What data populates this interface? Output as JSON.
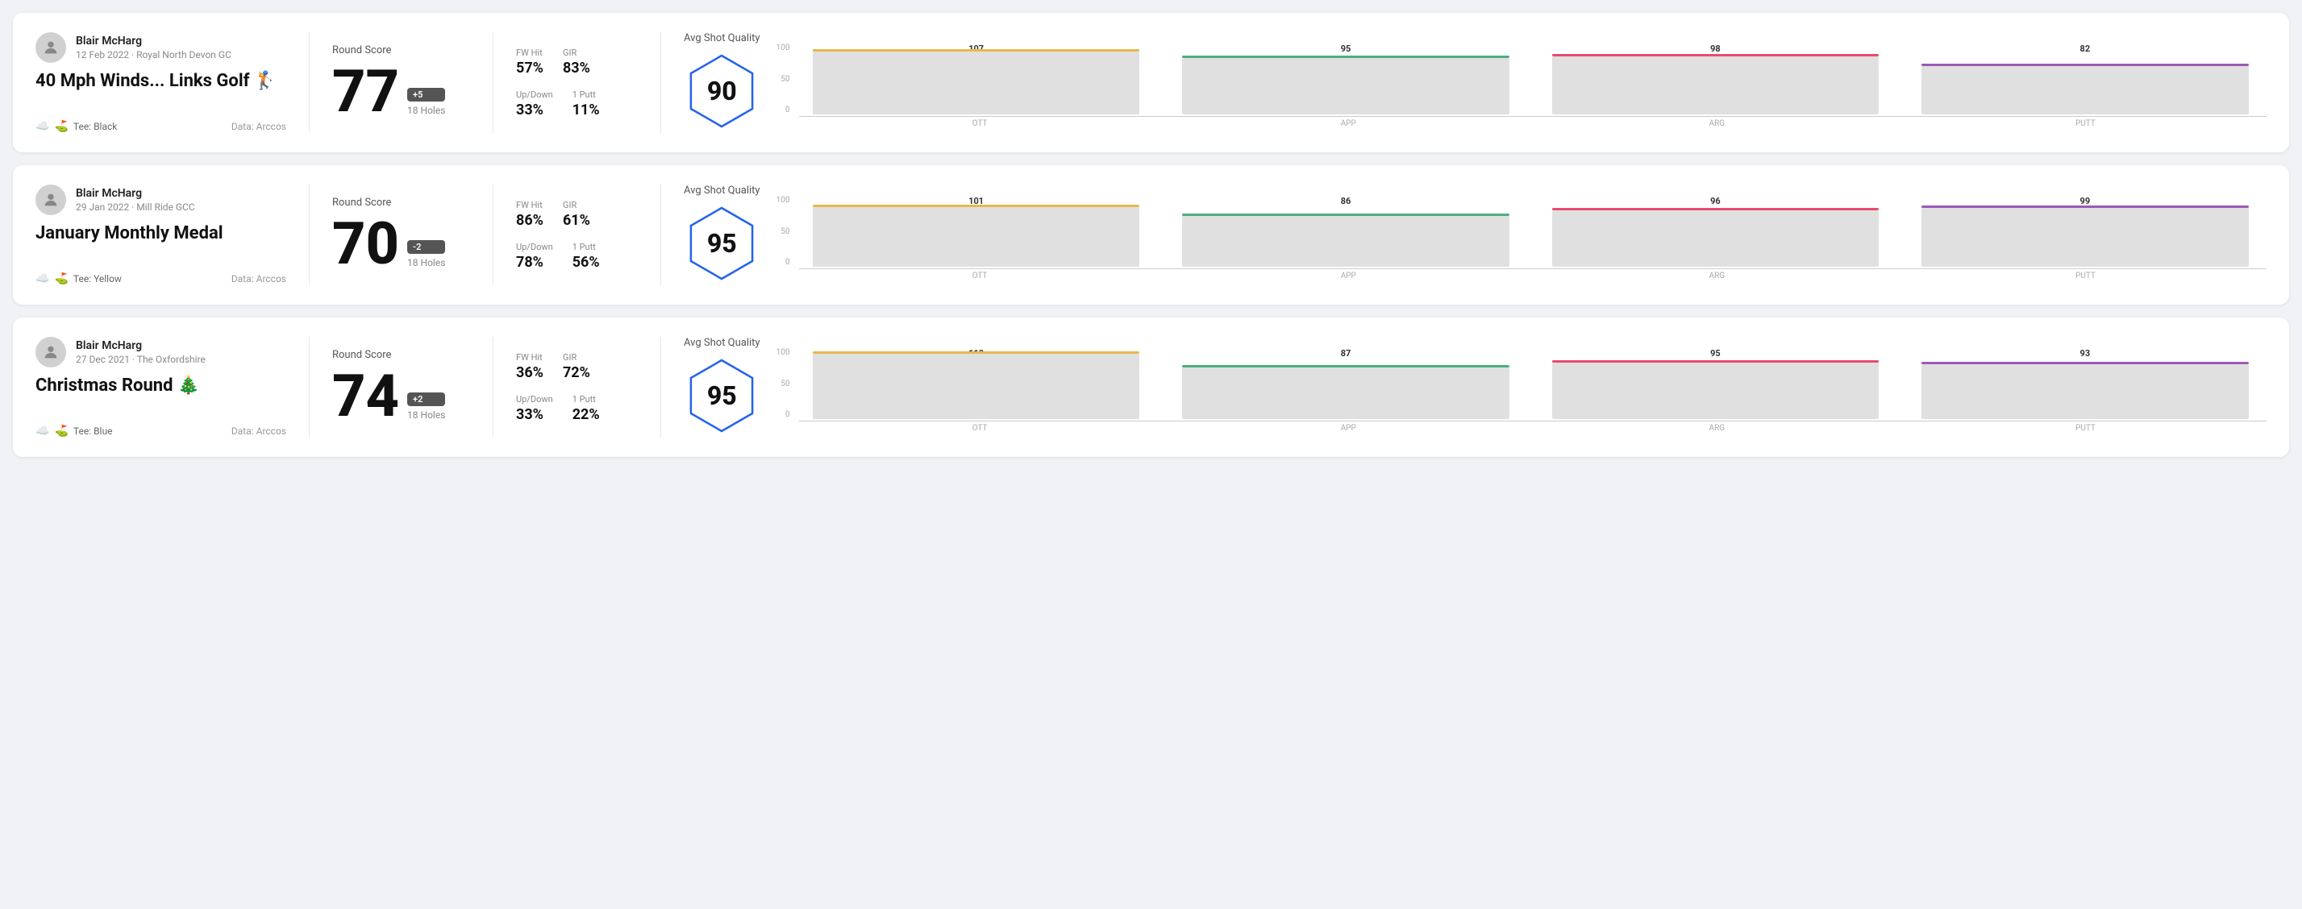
{
  "cards": [
    {
      "id": "round1",
      "user": {
        "name": "Blair McHarg",
        "meta": "12 Feb 2022 · Royal North Devon GC"
      },
      "title": "40 Mph Winds... Links Golf 🏌️",
      "tee": "Tee: Black",
      "data_source": "Data: Arccos",
      "score": {
        "label": "Round Score",
        "number": "77",
        "badge": "+5",
        "holes": "18 Holes"
      },
      "stats": {
        "fw_hit_label": "FW Hit",
        "fw_hit_value": "57%",
        "gir_label": "GIR",
        "gir_value": "83%",
        "updown_label": "Up/Down",
        "updown_value": "33%",
        "oneputt_label": "1 Putt",
        "oneputt_value": "11%"
      },
      "quality": {
        "label": "Avg Shot Quality",
        "score": "90",
        "bars": [
          {
            "category": "OTT",
            "value": 107,
            "color": "#e8b84b"
          },
          {
            "category": "APP",
            "value": 95,
            "color": "#4caf7d"
          },
          {
            "category": "ARG",
            "value": 98,
            "color": "#e84b6e"
          },
          {
            "category": "PUTT",
            "value": 82,
            "color": "#9b59b6"
          }
        ]
      }
    },
    {
      "id": "round2",
      "user": {
        "name": "Blair McHarg",
        "meta": "29 Jan 2022 · Mill Ride GCC"
      },
      "title": "January Monthly Medal",
      "tee": "Tee: Yellow",
      "data_source": "Data: Arccos",
      "score": {
        "label": "Round Score",
        "number": "70",
        "badge": "-2",
        "holes": "18 Holes"
      },
      "stats": {
        "fw_hit_label": "FW Hit",
        "fw_hit_value": "86%",
        "gir_label": "GIR",
        "gir_value": "61%",
        "updown_label": "Up/Down",
        "updown_value": "78%",
        "oneputt_label": "1 Putt",
        "oneputt_value": "56%"
      },
      "quality": {
        "label": "Avg Shot Quality",
        "score": "95",
        "bars": [
          {
            "category": "OTT",
            "value": 101,
            "color": "#e8b84b"
          },
          {
            "category": "APP",
            "value": 86,
            "color": "#4caf7d"
          },
          {
            "category": "ARG",
            "value": 96,
            "color": "#e84b6e"
          },
          {
            "category": "PUTT",
            "value": 99,
            "color": "#9b59b6"
          }
        ]
      }
    },
    {
      "id": "round3",
      "user": {
        "name": "Blair McHarg",
        "meta": "27 Dec 2021 · The Oxfordshire"
      },
      "title": "Christmas Round 🎄",
      "tee": "Tee: Blue",
      "data_source": "Data: Arccos",
      "score": {
        "label": "Round Score",
        "number": "74",
        "badge": "+2",
        "holes": "18 Holes"
      },
      "stats": {
        "fw_hit_label": "FW Hit",
        "fw_hit_value": "36%",
        "gir_label": "GIR",
        "gir_value": "72%",
        "updown_label": "Up/Down",
        "updown_value": "33%",
        "oneputt_label": "1 Putt",
        "oneputt_value": "22%"
      },
      "quality": {
        "label": "Avg Shot Quality",
        "score": "95",
        "bars": [
          {
            "category": "OTT",
            "value": 110,
            "color": "#e8b84b"
          },
          {
            "category": "APP",
            "value": 87,
            "color": "#4caf7d"
          },
          {
            "category": "ARG",
            "value": 95,
            "color": "#e84b6e"
          },
          {
            "category": "PUTT",
            "value": 93,
            "color": "#9b59b6"
          }
        ]
      }
    }
  ],
  "yaxis": {
    "top": "100",
    "mid": "50",
    "bot": "0"
  }
}
